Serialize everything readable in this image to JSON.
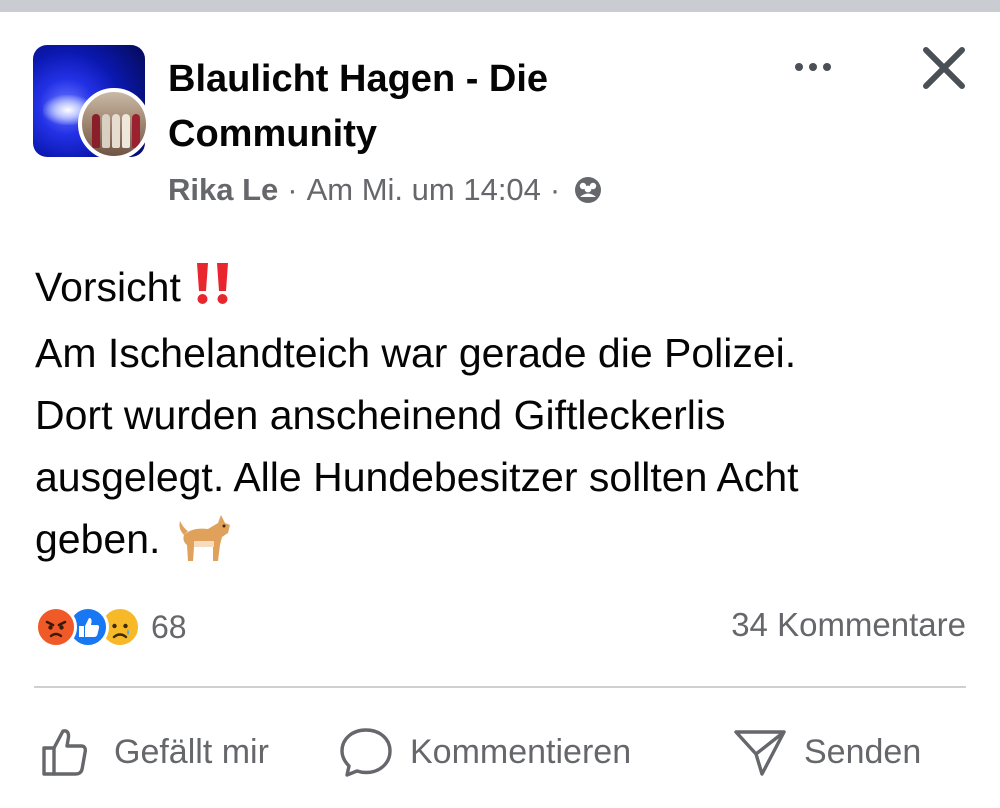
{
  "post": {
    "group_name": "Blaulicht Hagen - Die Community",
    "author": "Rika Le",
    "separator": "·",
    "timestamp": "Am Mi. um 14:04",
    "privacy_icon": "group-members-icon",
    "text_lines": [
      "Vorsicht",
      "Am Ischelandteich war gerade die Polizei.",
      "Dort wurden anscheinend Giftleckerlis",
      "ausgelegt. Alle Hundebesitzer sollten Acht",
      "geben."
    ]
  },
  "header_controls": {
    "more_icon": "more-horizontal-icon",
    "close_icon": "close-icon"
  },
  "stats": {
    "reactions": [
      "angry",
      "like",
      "sad"
    ],
    "reaction_count": "68",
    "comments_label": "34 Kommentare"
  },
  "actions": {
    "like_label": "Gefällt mir",
    "comment_label": "Kommentieren",
    "send_label": "Senden"
  },
  "colors": {
    "secondary_text": "#65676b",
    "like_blue": "#1877f2",
    "angry_orange": "#f05a28",
    "sad_yellow": "#f7b928",
    "exclamation_red": "#e8262e"
  }
}
